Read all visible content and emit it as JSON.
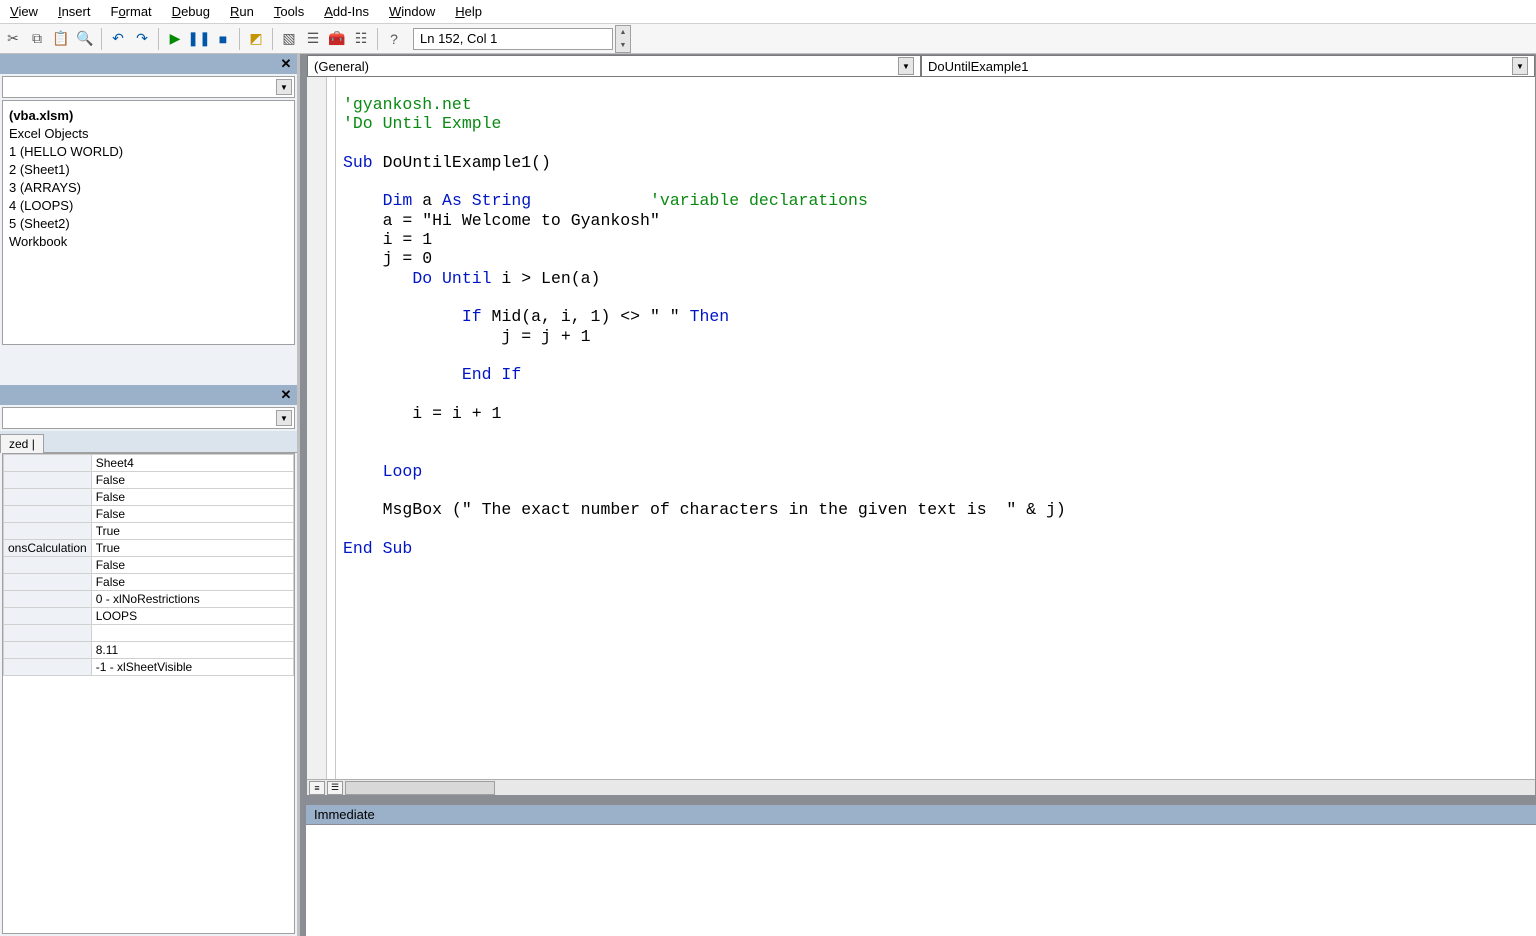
{
  "menu": [
    "View",
    "Insert",
    "Format",
    "Debug",
    "Run",
    "Tools",
    "Add-Ins",
    "Window",
    "Help"
  ],
  "toolbar_position": "Ln 152, Col 1",
  "project": {
    "title": "(vba.xlsm)",
    "items": [
      "Excel Objects",
      "1 (HELLO WORLD)",
      "2 (Sheet1)",
      "3 (ARRAYS)",
      "4 (LOOPS)",
      "5 (Sheet2)",
      "Workbook"
    ]
  },
  "properties": {
    "tab": "zed",
    "rows": [
      {
        "k": "",
        "v": "Sheet4"
      },
      {
        "k": "",
        "v": "False"
      },
      {
        "k": "",
        "v": "False"
      },
      {
        "k": "",
        "v": "False"
      },
      {
        "k": "",
        "v": "True"
      },
      {
        "k": "onsCalculation",
        "v": "True"
      },
      {
        "k": "",
        "v": "False"
      },
      {
        "k": "",
        "v": "False"
      },
      {
        "k": "",
        "v": "0 - xlNoRestrictions"
      },
      {
        "k": "",
        "v": "LOOPS"
      },
      {
        "k": "",
        "v": ""
      },
      {
        "k": "",
        "v": "8.11"
      },
      {
        "k": "",
        "v": "-1 - xlSheetVisible"
      }
    ]
  },
  "code": {
    "combo_left": "(General)",
    "combo_right": "DoUntilExample1",
    "tokens": [
      {
        "t": "'gyankosh.net",
        "c": "cm"
      },
      {
        "t": "\n"
      },
      {
        "t": "'Do Until Exmple",
        "c": "cm"
      },
      {
        "t": "\n\n"
      },
      {
        "t": "Sub",
        "c": "kw"
      },
      {
        "t": " DoUntilExample1()\n\n"
      },
      {
        "t": "    "
      },
      {
        "t": "Dim",
        "c": "kw"
      },
      {
        "t": " a "
      },
      {
        "t": "As",
        "c": "kw"
      },
      {
        "t": " "
      },
      {
        "t": "String",
        "c": "kw"
      },
      {
        "t": "            "
      },
      {
        "t": "'variable declarations",
        "c": "cm"
      },
      {
        "t": "\n"
      },
      {
        "t": "    a = \"Hi Welcome to Gyankosh\"\n"
      },
      {
        "t": "    i = 1\n"
      },
      {
        "t": "    j = 0\n"
      },
      {
        "t": "       "
      },
      {
        "t": "Do Until",
        "c": "kw"
      },
      {
        "t": " i > Len(a)\n\n"
      },
      {
        "t": "            "
      },
      {
        "t": "If",
        "c": "kw"
      },
      {
        "t": " Mid(a, i, 1) <> \" \" "
      },
      {
        "t": "Then",
        "c": "kw"
      },
      {
        "t": "\n"
      },
      {
        "t": "                j = j + 1\n\n"
      },
      {
        "t": "            "
      },
      {
        "t": "End If",
        "c": "kw"
      },
      {
        "t": "\n\n"
      },
      {
        "t": "       i = i + 1\n\n\n"
      },
      {
        "t": "    "
      },
      {
        "t": "Loop",
        "c": "kw"
      },
      {
        "t": "\n\n"
      },
      {
        "t": "    MsgBox (\" The exact number of characters in the given text is  \" & j)\n\n"
      },
      {
        "t": "End Sub",
        "c": "kw"
      }
    ]
  },
  "immediate_title": "Immediate"
}
